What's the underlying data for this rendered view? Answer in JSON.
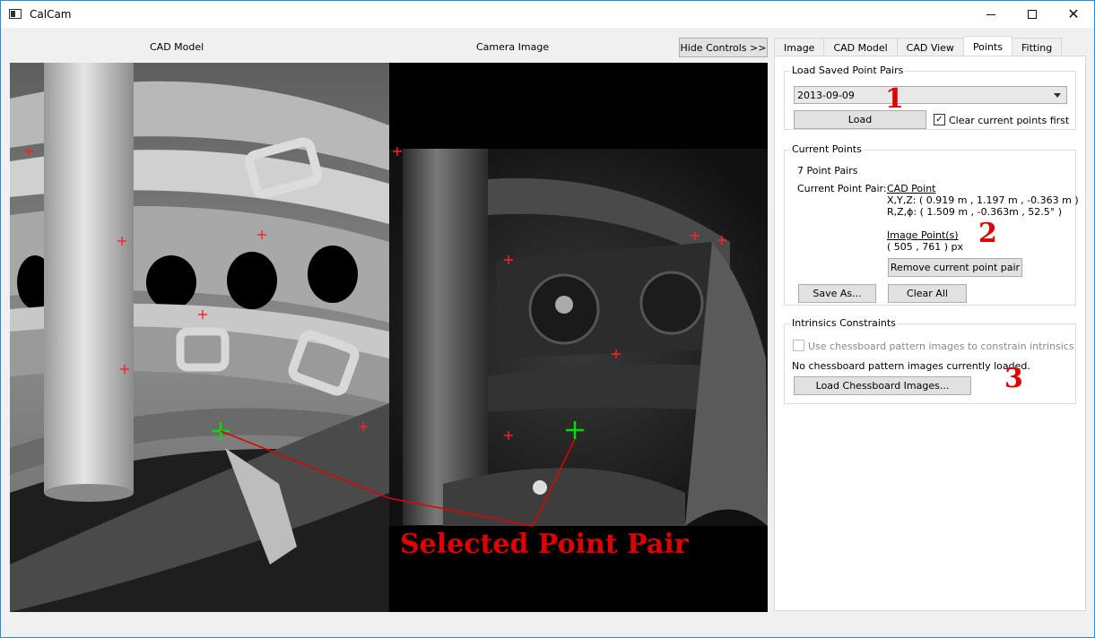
{
  "window": {
    "title": "CalCam"
  },
  "views": {
    "cad_label": "CAD Model",
    "camera_label": "Camera Image",
    "hide_controls": "Hide Controls >>",
    "selected_annotation": "Selected Point Pair"
  },
  "tabs": [
    "Image",
    "CAD Model",
    "CAD View",
    "Points",
    "Fitting"
  ],
  "active_tab": "Points",
  "load_saved": {
    "title": "Load Saved Point Pairs",
    "selected": "2013-09-09",
    "load_button": "Load",
    "clear_checkbox_label": "Clear current points first",
    "clear_checked": true
  },
  "current_points": {
    "title": "Current Points",
    "count_text": "7 Point Pairs",
    "pair_label": "Current Point Pair:",
    "cad_point_heading": "CAD Point",
    "xyz": "X,Y,Z: ( 0.919 m , 1.197 m , -0.363 m )",
    "rzphi": "R,Z,ϕ: ( 1.509 m , -0.363m , 52.5° )",
    "image_point_heading": "Image Point(s)",
    "image_point": "( 505 , 761 ) px",
    "remove_button": "Remove current point pair",
    "save_as_button": "Save As...",
    "clear_all_button": "Clear All"
  },
  "intrinsics": {
    "title": "Intrinsics Constraints",
    "checkbox_label": "Use chessboard pattern images to constrain intrinsics",
    "status": "No chessboard pattern images currently loaded.",
    "load_button": "Load Chessboard Images..."
  },
  "annotations": [
    "1",
    "2",
    "3"
  ],
  "colors": {
    "title_border": "#2b8ad6",
    "annotation": "#e00000",
    "selected_marker": "#00dd00",
    "point_marker": "#ff2222"
  }
}
